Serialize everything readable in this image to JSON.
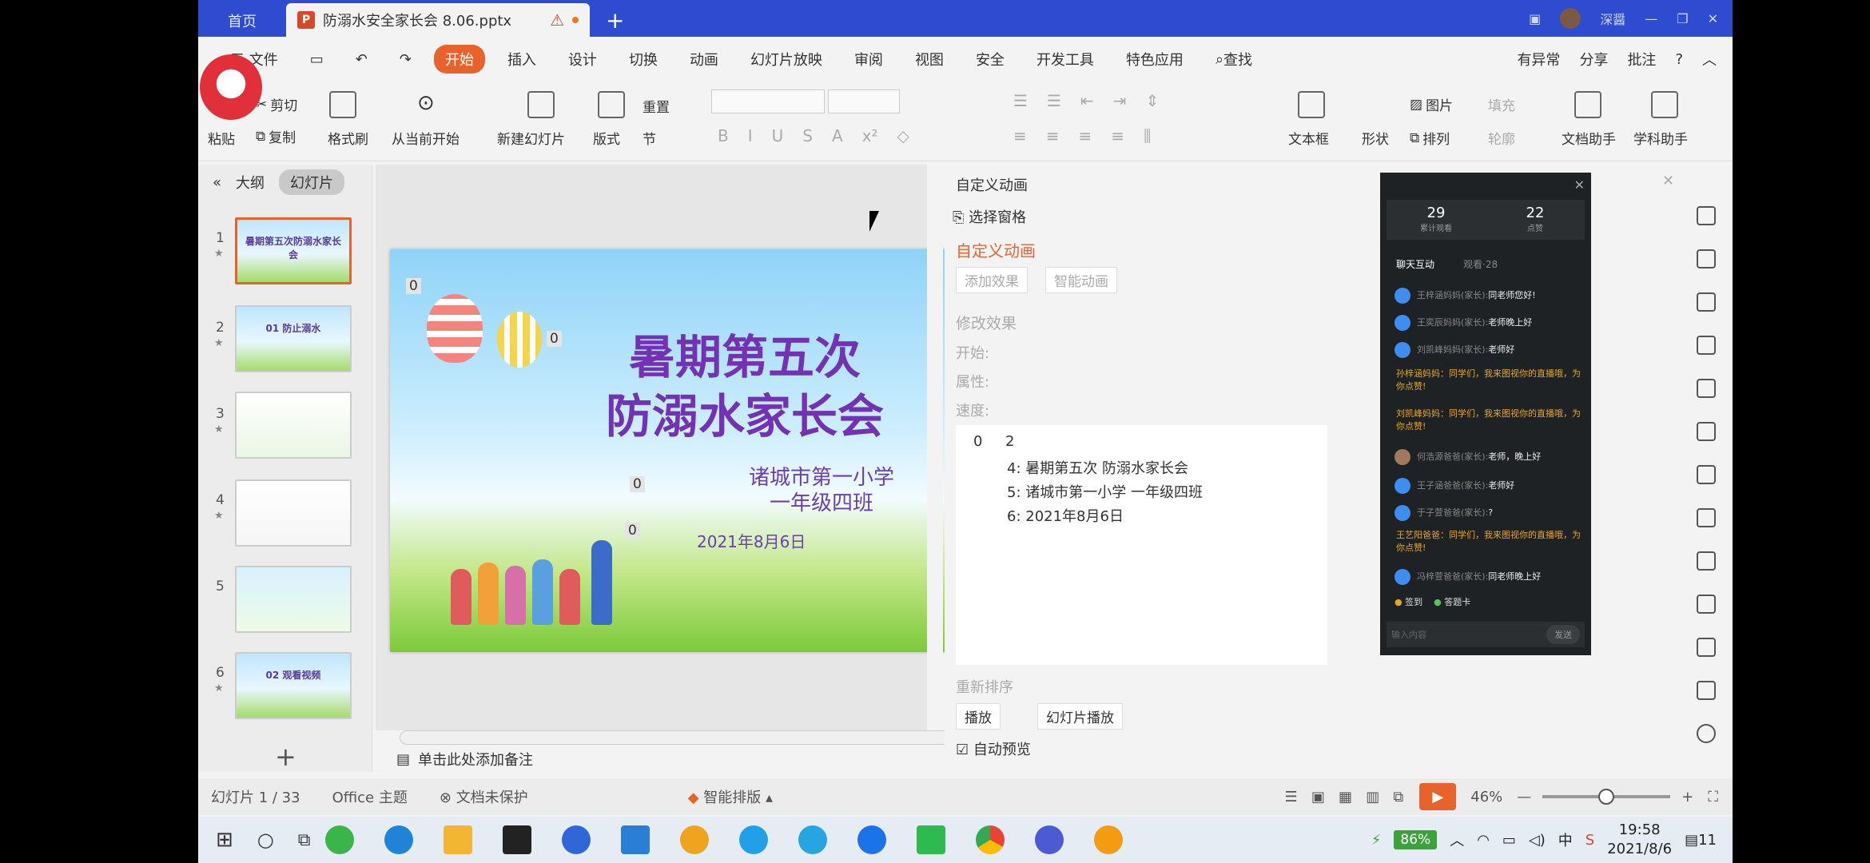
{
  "titlebar": {
    "home_tab": "首页",
    "doc_tab": "防溺水安全家长会 8.06.pptx",
    "user": "深醤"
  },
  "menu": {
    "file": "三 文件",
    "items": [
      "开始",
      "插入",
      "设计",
      "切换",
      "动画",
      "幻灯片放映",
      "审阅",
      "视图",
      "安全",
      "开发工具",
      "特色应用"
    ],
    "search": "查找",
    "right": [
      "有异常",
      "分享",
      "批注"
    ]
  },
  "ribbon": {
    "paste": "粘贴",
    "cut": "剪切",
    "copy": "复制",
    "format_painter": "格式刷",
    "from_current": "从当前开始",
    "new_slide": "新建幻灯片",
    "layout": "版式",
    "reset": "重置",
    "section": "节",
    "textbox": "文本框",
    "shape": "形状",
    "picture": "图片",
    "fill": "填充",
    "arrange": "排列",
    "outline": "轮廓",
    "doc_helper": "文档助手",
    "subject_helper": "学科助手"
  },
  "left_panel": {
    "tab_outline": "大纲",
    "tab_slides": "幻灯片",
    "thumbnails": [
      {
        "num": "1",
        "title": "暑期第五次防溺水家长会"
      },
      {
        "num": "2",
        "title": "01 防止溺水"
      },
      {
        "num": "3",
        "title": ""
      },
      {
        "num": "4",
        "title": ""
      },
      {
        "num": "5",
        "title": ""
      },
      {
        "num": "6",
        "title": "02 观看视频"
      }
    ]
  },
  "slide": {
    "title_line1": "暑期第五次",
    "title_line2": "防溺水家长会",
    "school": "诸城市第一小学",
    "class": "一年级四班",
    "date": "2021年8月6日",
    "anim_badges": [
      "0",
      "0",
      "0",
      "0"
    ]
  },
  "notes_placeholder": "单击此处添加备注",
  "anim_pane": {
    "header": "自定义动画",
    "select_pane": "选择窗格",
    "title": "自定义动画",
    "add_effect": "添加效果",
    "smart_anim": "智能动画",
    "modify": "修改效果",
    "start": "开始:",
    "property": "属性:",
    "speed": "速度:",
    "list_group_num": "0",
    "list_group_label": "2",
    "list_items": [
      "4: 暑期第五次 防溺水家长会",
      "5: 诸城市第一小学 一年级四班",
      "6: 2021年8月6日"
    ],
    "reorder": "重新排序",
    "play": "播放",
    "slideshow": "幻灯片播放",
    "auto_preview": "自动预览"
  },
  "chat": {
    "stat1_value": "29",
    "stat1_label": "累计观看",
    "stat2_value": "22",
    "stat2_label": "点赞",
    "tab1": "聊天互动",
    "tab2": "观看·28",
    "messages": [
      {
        "name": "王梓涵妈妈(家长):",
        "text": "同老师您好!"
      },
      {
        "name": "王奕辰妈妈(家长):",
        "text": "老师晚上好"
      },
      {
        "name": "刘凯峰妈妈(家长):",
        "text": "老师好"
      },
      {
        "gold": "孙梓涵妈妈：同学们，我来图视你的直播哦，为你点赞!"
      },
      {
        "gold": "刘凯峰妈妈：同学们，我来图视你的直播哦，为你点赞!"
      },
      {
        "name": "何浩源爸爸(家长):",
        "text": "老师，晚上好"
      },
      {
        "name": "王子涵爸爸(家长):",
        "text": "老师好"
      },
      {
        "name": "于子萱爸爸(家长):",
        "text": "?"
      },
      {
        "gold": "王艺阳爸爸：同学们，我来图视你的直播哦，为你点赞!"
      },
      {
        "name": "冯梓萱爸爸(家长):",
        "text": "同老师晚上好"
      }
    ],
    "tag1": "签到",
    "tag2": "答题卡",
    "input_placeholder": "输入内容",
    "send": "发送"
  },
  "statusbar": {
    "slide_info": "幻灯片 1 / 33",
    "theme": "Office 主题",
    "protect": "文档未保护",
    "smart_layout": "智能排版",
    "zoom": "46%"
  },
  "taskbar": {
    "battery": "86%",
    "time": "19:58",
    "date": "2021/8/6",
    "notif": "11"
  },
  "colors": {
    "accent": "#e8632b",
    "titlebar": "#2f4bcf",
    "slide_title": "#7332b3"
  }
}
